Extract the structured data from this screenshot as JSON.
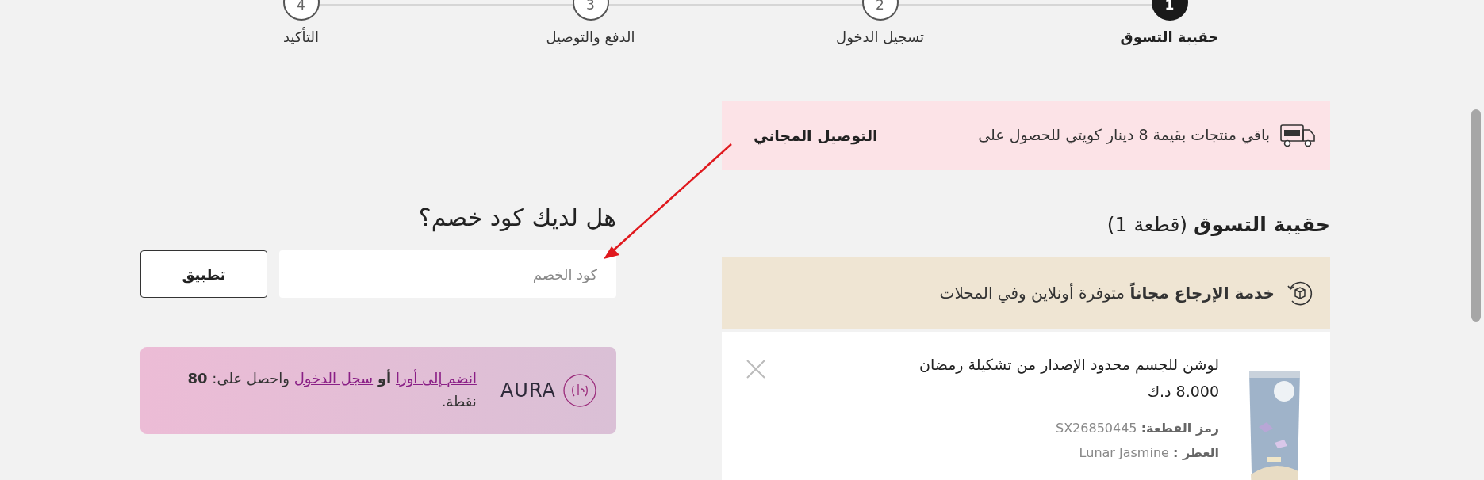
{
  "steps": [
    {
      "number": "1",
      "label": "حقيبة التسوق",
      "selected": true
    },
    {
      "number": "2",
      "label": "تسجيل الدخول",
      "selected": false
    },
    {
      "number": "3",
      "label": "الدفع والتوصيل",
      "selected": false
    },
    {
      "number": "4",
      "label": "التأكيد",
      "selected": false
    }
  ],
  "free_delivery": {
    "text": "باقي منتجات بقيمة 8 دينار كويتي للحصول على",
    "highlight": "التوصيل المجاني"
  },
  "bag_heading": "**حقيبة التسوق** (قطعة 1)",
  "returns_banner": "**خدمة الإرجاع مجاناً** متوفرة أونلاين وفي المحلات",
  "product": {
    "title": "لوشن للجسم محدود الإصدار من تشكيلة رمضان",
    "price": "8.000 د.ك",
    "code_label": "رمز القطعة:",
    "code": "SX26850445",
    "fragrance_label": "العطر :",
    "fragrance": "Lunar Jasmine"
  },
  "discount": {
    "title": "هل لديك كود خصم؟",
    "placeholder": "كود الخصم",
    "button": "تطبيق"
  },
  "aura": {
    "brand": "AURA",
    "join_link": "انضم إلى أورا",
    "connector": "أو",
    "login_link": "سجل الدخول",
    "rest": "واحصل على: **80** نقطة."
  }
}
